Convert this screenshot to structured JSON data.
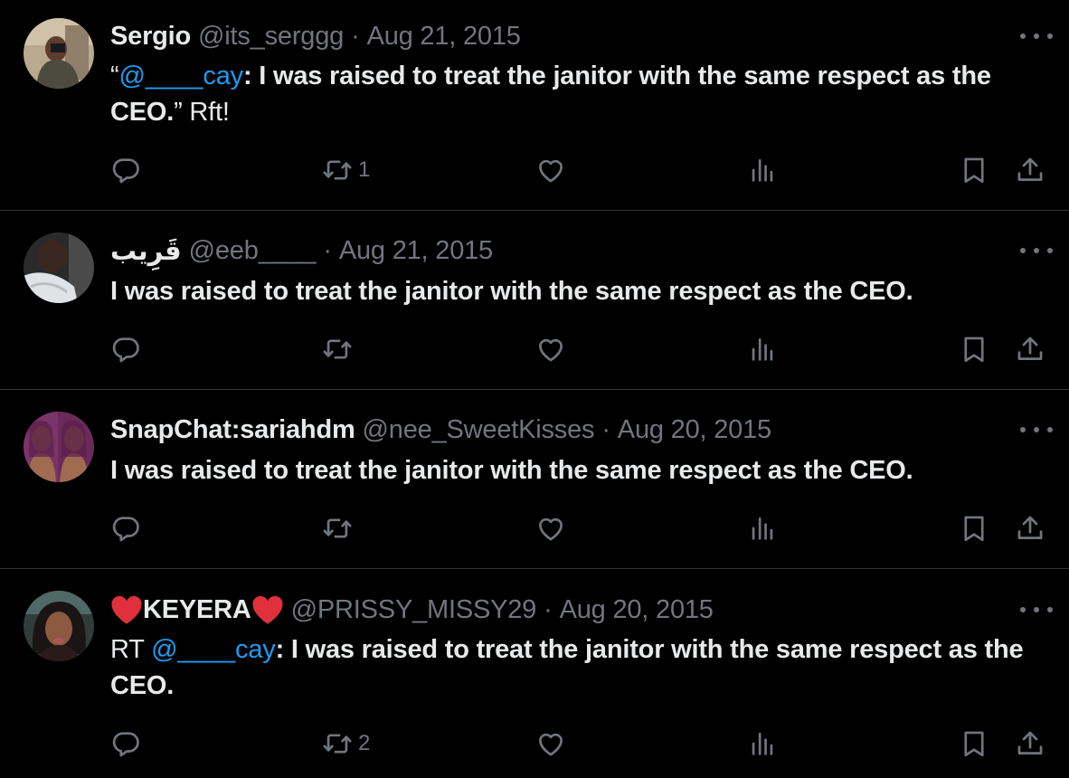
{
  "tweets": [
    {
      "name": "Sergio",
      "handle": "@its_serggg",
      "separator": "·",
      "date": "Aug 21, 2015",
      "text_prefix": "“",
      "mention": "@____cay",
      "text_bold": ": I was raised to treat the janitor with the same respect as the CEO.",
      "text_suffix": "” Rft!",
      "retweet_count": "1"
    },
    {
      "name": "قَرِيب",
      "handle": "@eeb____",
      "separator": "·",
      "date": "Aug 21, 2015",
      "text_bold": "I was raised to treat the janitor with the same respect as the CEO."
    },
    {
      "name": "SnapChat:sariahdm",
      "handle": "@nee_SweetKisses",
      "separator": "·",
      "date": "Aug 20, 2015",
      "text_bold": "I was raised to treat the janitor with the same respect as the CEO."
    },
    {
      "name": "KEYERA",
      "handle": "@PRISSY_MISSY29",
      "separator": "·",
      "date": "Aug 20, 2015",
      "text_prefix": "RT ",
      "mention": "@____cay",
      "text_bold": ": I was raised to treat the janitor with the same respect as the CEO.",
      "retweet_count": "2"
    }
  ],
  "icons": {
    "reply": "reply-icon",
    "retweet": "retweet-icon",
    "like": "like-icon",
    "views": "views-icon",
    "bookmark": "bookmark-icon",
    "share": "share-icon",
    "more": "more-icon",
    "name_emoji": "red-heart-emoji"
  },
  "colors": {
    "background": "#000000",
    "text": "#e7e9ea",
    "secondary": "#71767b",
    "mention": "#1d9bf0",
    "divider": "#2f3336",
    "heart": "#e0303c"
  }
}
